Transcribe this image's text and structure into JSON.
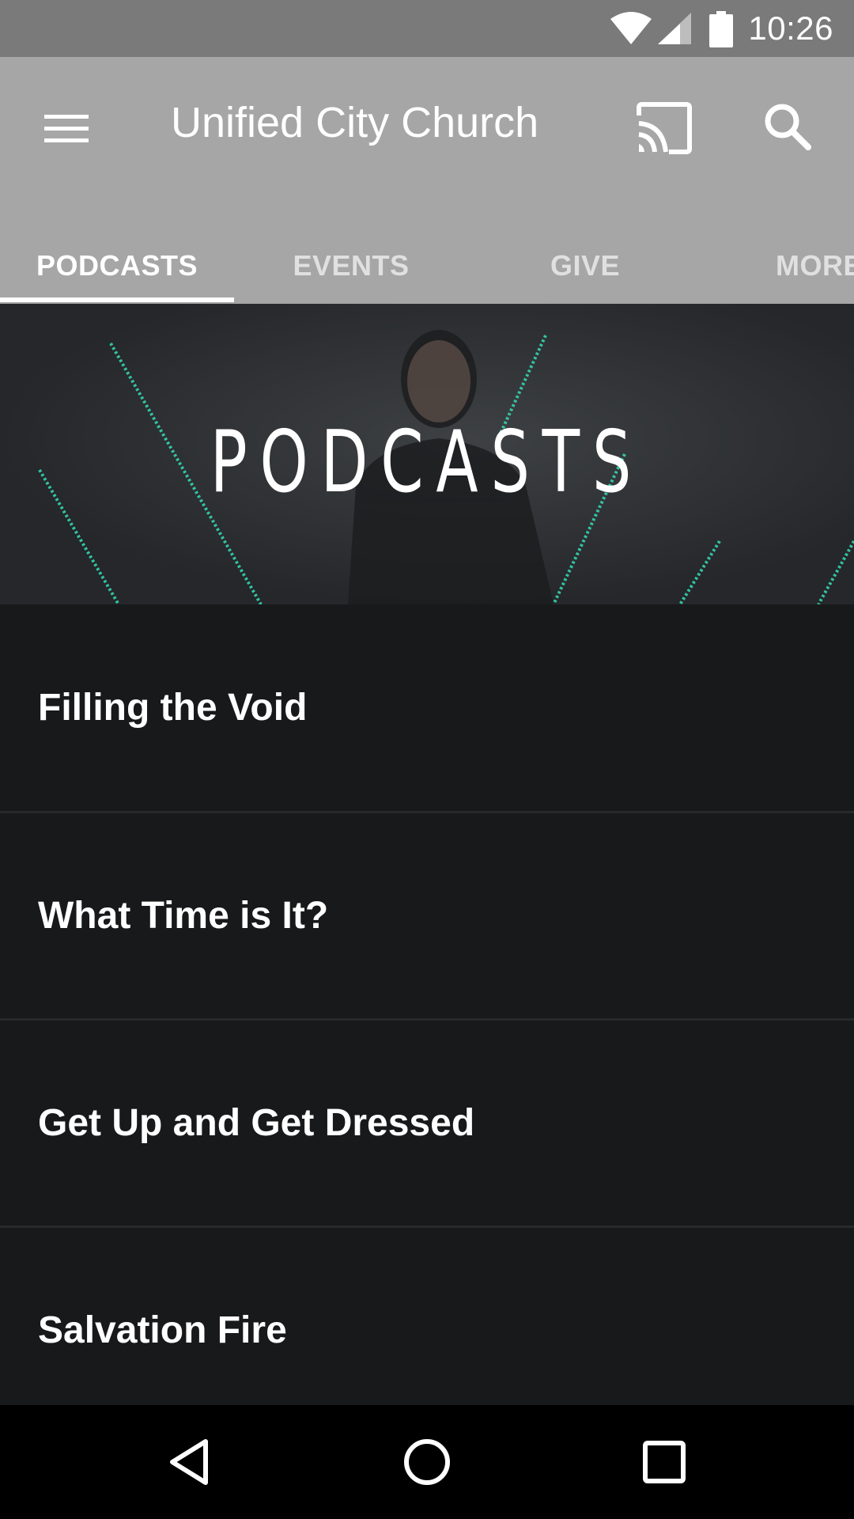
{
  "status_bar": {
    "time": "10:26",
    "icons": [
      "wifi-icon",
      "cell-signal-icon",
      "battery-icon"
    ]
  },
  "app_bar": {
    "title": "Unified City Church",
    "icons": [
      "menu-icon",
      "cast-icon",
      "search-icon"
    ],
    "background": "#a6a6a6"
  },
  "tabs": [
    {
      "label": "PODCASTS",
      "active": true
    },
    {
      "label": "EVENTS",
      "active": false
    },
    {
      "label": "GIVE",
      "active": false
    },
    {
      "label": "MORE",
      "active": false
    }
  ],
  "hero": {
    "title": "PODCASTS",
    "accent": "#35d3b0"
  },
  "podcasts": [
    {
      "title": "Filling the Void"
    },
    {
      "title": "What Time is It?"
    },
    {
      "title": "Get Up and Get Dressed"
    },
    {
      "title": "Salvation Fire"
    }
  ],
  "nav_bar": {
    "icons": [
      "back-icon",
      "home-icon",
      "recents-icon"
    ]
  }
}
